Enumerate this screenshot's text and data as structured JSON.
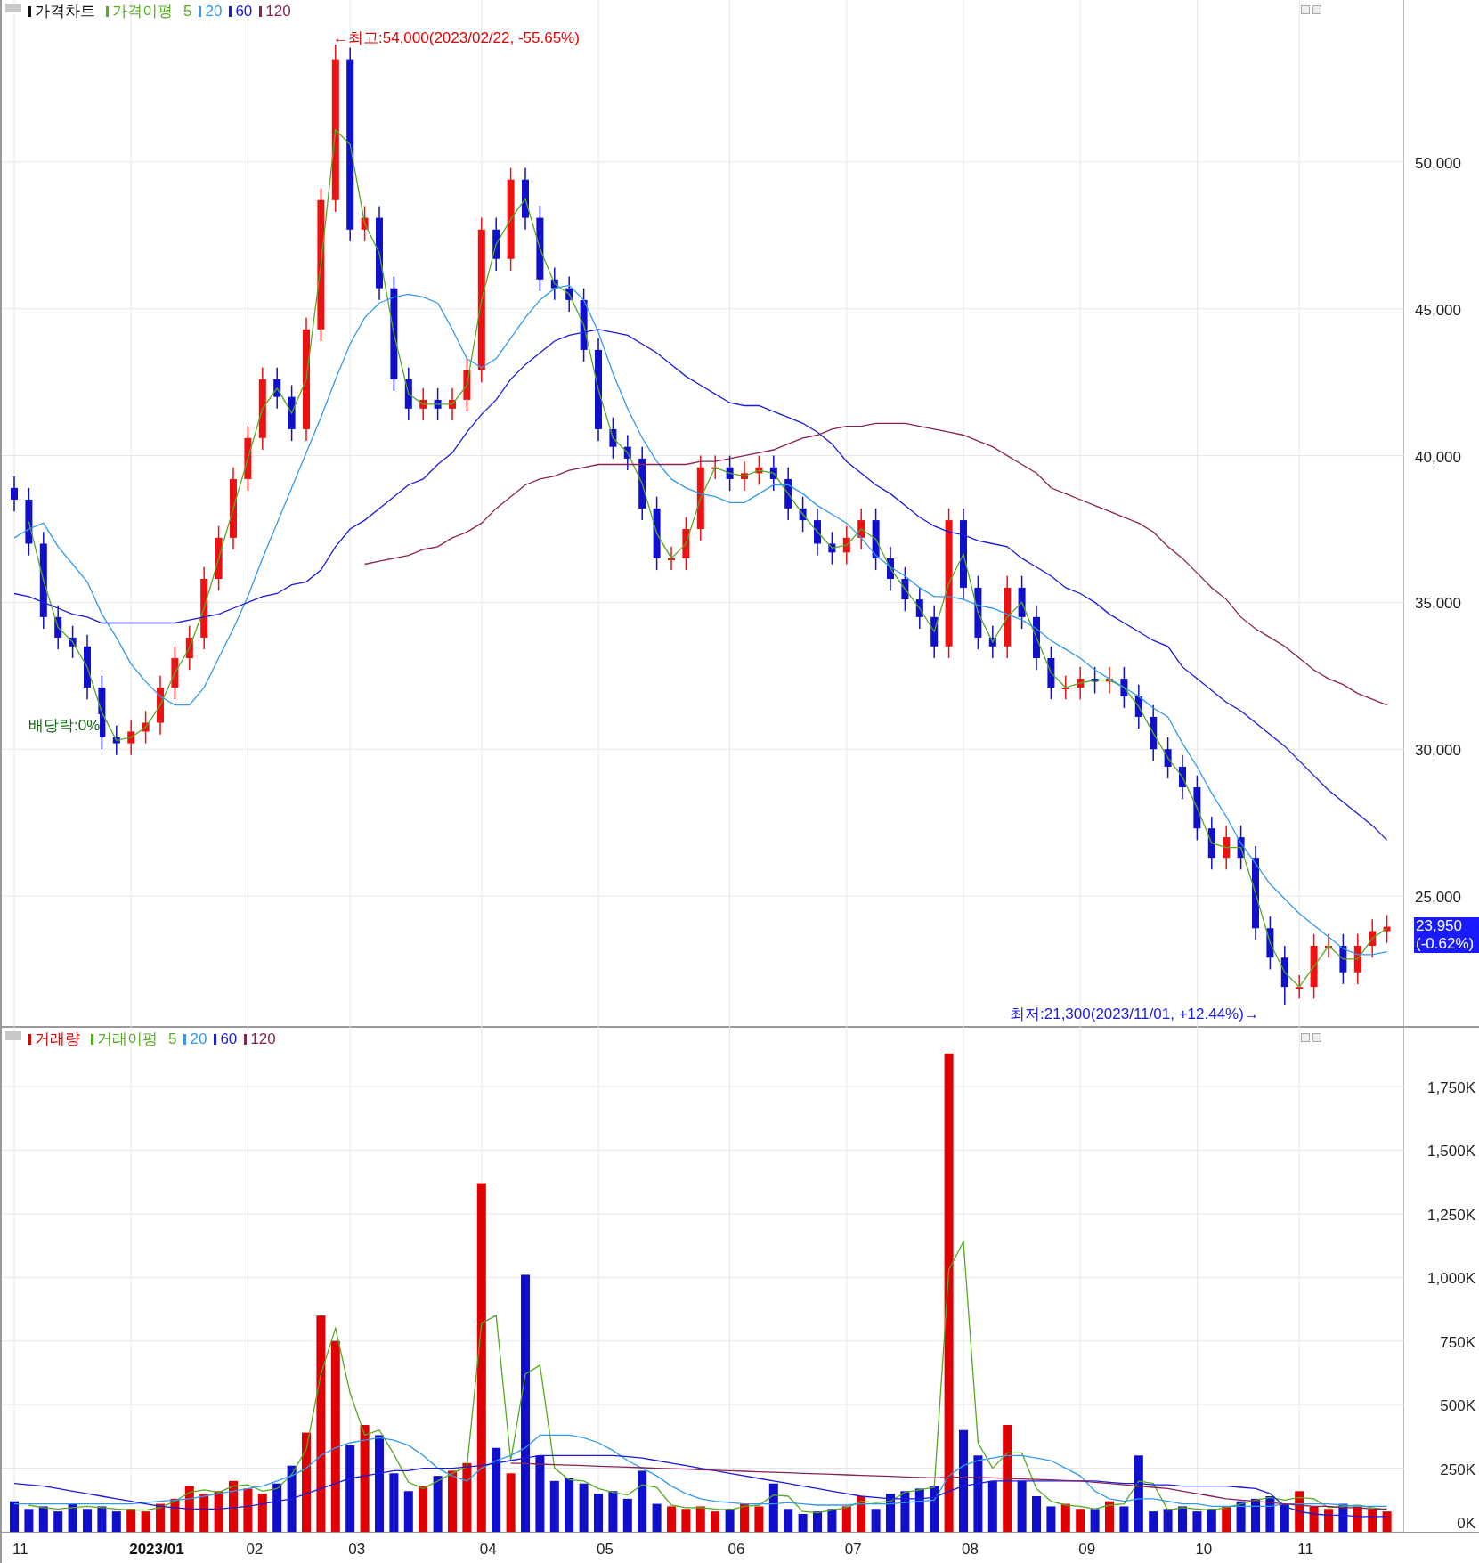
{
  "price_panel": {
    "legend": {
      "title": "가격차트",
      "ma_label": "가격이평"
    },
    "high_marker": "←최고:54,000(2023/02/22, -55.65%)",
    "low_marker": "최저:21,300(2023/11/01, +12.44%)→",
    "dividend_marker": "배당락:0%",
    "current_price": "23,950",
    "current_change": "(-0.62%)",
    "chart_data": {
      "type": "candlestick",
      "ylim": [
        20510,
        55520
      ],
      "grid": true,
      "legend": "upper left",
      "yticks": [
        {
          "value": 25000,
          "label": "25,000"
        },
        {
          "value": 30000,
          "label": "30,000"
        },
        {
          "value": 35000,
          "label": "35,000"
        },
        {
          "value": 40000,
          "label": "40,000"
        },
        {
          "value": 45000,
          "label": "45,000"
        },
        {
          "value": 50000,
          "label": "50,000"
        }
      ],
      "ohlc": [
        [
          38900,
          39300,
          38100,
          38500
        ],
        [
          38500,
          38900,
          36600,
          37000
        ],
        [
          37000,
          37400,
          34100,
          34500
        ],
        [
          34500,
          34900,
          33400,
          33800
        ],
        [
          33800,
          34200,
          33100,
          33500
        ],
        [
          33500,
          33900,
          31700,
          32100
        ],
        [
          32100,
          32500,
          30000,
          30400
        ],
        [
          30400,
          30800,
          29800,
          30200
        ],
        [
          30200,
          31000,
          29800,
          30600
        ],
        [
          30600,
          31300,
          30200,
          30900
        ],
        [
          30900,
          32500,
          30500,
          32100
        ],
        [
          32100,
          33500,
          31700,
          33100
        ],
        [
          33100,
          34200,
          32700,
          33800
        ],
        [
          33800,
          36200,
          33400,
          35800
        ],
        [
          35800,
          37600,
          35400,
          37200
        ],
        [
          37200,
          39600,
          36800,
          39200
        ],
        [
          39200,
          41000,
          38800,
          40600
        ],
        [
          40600,
          43000,
          40200,
          42600
        ],
        [
          42600,
          43000,
          41600,
          42000
        ],
        [
          42000,
          42400,
          40500,
          40900
        ],
        [
          40900,
          44700,
          40500,
          44300
        ],
        [
          44300,
          49100,
          43900,
          48700
        ],
        [
          48700,
          54000,
          48300,
          53500
        ],
        [
          53500,
          53900,
          47300,
          47700
        ],
        [
          47700,
          48500,
          47300,
          48100
        ],
        [
          48100,
          48500,
          45300,
          45700
        ],
        [
          45700,
          46100,
          42200,
          42600
        ],
        [
          42600,
          43000,
          41200,
          41600
        ],
        [
          41600,
          42300,
          41200,
          41900
        ],
        [
          41900,
          42300,
          41200,
          41600
        ],
        [
          41600,
          42300,
          41200,
          41900
        ],
        [
          41900,
          43300,
          41500,
          42900
        ],
        [
          42900,
          48100,
          42500,
          47700
        ],
        [
          47700,
          48100,
          46300,
          46700
        ],
        [
          46700,
          49800,
          46300,
          49400
        ],
        [
          49400,
          49800,
          47700,
          48100
        ],
        [
          48100,
          48500,
          45600,
          46000
        ],
        [
          46000,
          46400,
          45300,
          45700
        ],
        [
          45700,
          46100,
          44900,
          45300
        ],
        [
          45300,
          45700,
          43200,
          43600
        ],
        [
          43600,
          44000,
          40500,
          40900
        ],
        [
          40900,
          41300,
          39900,
          40300
        ],
        [
          40300,
          40700,
          39500,
          39900
        ],
        [
          39900,
          40300,
          37800,
          38200
        ],
        [
          38200,
          38600,
          36100,
          36500
        ],
        [
          36500,
          36900,
          36100,
          36500
        ],
        [
          36500,
          37900,
          36100,
          37500
        ],
        [
          37500,
          40000,
          37100,
          39600
        ],
        [
          39600,
          40000,
          39200,
          39600
        ],
        [
          39600,
          40000,
          38800,
          39200
        ],
        [
          39200,
          39800,
          38800,
          39400
        ],
        [
          39400,
          40000,
          39000,
          39600
        ],
        [
          39600,
          40000,
          38800,
          39200
        ],
        [
          39200,
          39600,
          37800,
          38200
        ],
        [
          38200,
          38600,
          37400,
          37800
        ],
        [
          37800,
          38200,
          36600,
          37000
        ],
        [
          37000,
          37400,
          36300,
          36700
        ],
        [
          36700,
          37600,
          36300,
          37200
        ],
        [
          37200,
          38200,
          36800,
          37800
        ],
        [
          37800,
          38200,
          36100,
          36500
        ],
        [
          36500,
          36900,
          35400,
          35800
        ],
        [
          35800,
          36200,
          34700,
          35100
        ],
        [
          35100,
          35500,
          34100,
          34500
        ],
        [
          34500,
          34900,
          33100,
          33500
        ],
        [
          33500,
          38200,
          33100,
          37800
        ],
        [
          37800,
          38200,
          35100,
          35500
        ],
        [
          35500,
          35900,
          33400,
          33800
        ],
        [
          33800,
          34200,
          33100,
          33500
        ],
        [
          33500,
          35900,
          33100,
          35500
        ],
        [
          35500,
          35900,
          34100,
          34500
        ],
        [
          34500,
          34900,
          32700,
          33100
        ],
        [
          33100,
          33500,
          31700,
          32100
        ],
        [
          32100,
          32500,
          31700,
          32100
        ],
        [
          32100,
          32800,
          31700,
          32400
        ],
        [
          32400,
          32800,
          31900,
          32300
        ],
        [
          32300,
          32800,
          31900,
          32400
        ],
        [
          32400,
          32800,
          31400,
          31800
        ],
        [
          31800,
          32200,
          30700,
          31100
        ],
        [
          31100,
          31500,
          29600,
          30000
        ],
        [
          30000,
          30400,
          29000,
          29400
        ],
        [
          29400,
          29800,
          28300,
          28700
        ],
        [
          28700,
          29100,
          26900,
          27300
        ],
        [
          27300,
          27700,
          25900,
          26300
        ],
        [
          26300,
          27400,
          25900,
          27000
        ],
        [
          27000,
          27400,
          25900,
          26300
        ],
        [
          26300,
          26700,
          23500,
          23900
        ],
        [
          23900,
          24300,
          22500,
          22900
        ],
        [
          22900,
          23300,
          21300,
          21900
        ],
        [
          21900,
          22300,
          21500,
          21900
        ],
        [
          21900,
          23700,
          21500,
          23300
        ],
        [
          23300,
          23700,
          22900,
          23300
        ],
        [
          23300,
          23700,
          22000,
          22400
        ],
        [
          22400,
          23700,
          22000,
          23300
        ],
        [
          23300,
          24200,
          22900,
          23800
        ],
        [
          23800,
          24350,
          23400,
          23950
        ]
      ],
      "series": [
        {
          "name": "5",
          "type": "line",
          "color": "#55aa22",
          "values": [
            null,
            37750,
            35750,
            34150,
            33650,
            32800,
            31250,
            30300,
            30400,
            30750,
            31500,
            32600,
            33450,
            34800,
            36500,
            38200,
            39900,
            41600,
            42300,
            41450,
            42600,
            46500,
            51100,
            50600,
            47900,
            46900,
            44150,
            42100,
            41750,
            41750,
            41750,
            42400,
            45300,
            47200,
            48050,
            48750,
            47050,
            45850,
            45500,
            44450,
            42250,
            40600,
            40100,
            39050,
            37350,
            36500,
            37000,
            38550,
            39600,
            39400,
            39300,
            39500,
            39400,
            38700,
            38000,
            37400,
            36850,
            36950,
            37500,
            37150,
            36150,
            35450,
            34800,
            34000,
            35650,
            36650,
            34650,
            33650,
            34500,
            35000,
            33800,
            32600,
            32100,
            32250,
            32350,
            32350,
            32100,
            31450,
            30550,
            29700,
            29050,
            28000,
            26800,
            26650,
            26650,
            25100,
            23400,
            22400,
            21900,
            22600,
            23300,
            22850,
            22850,
            23550,
            23900
          ]
        },
        {
          "name": "20",
          "type": "line",
          "color": "#3399ee",
          "values": [
            37200,
            37500,
            37700,
            36900,
            36300,
            35700,
            34600,
            33800,
            32900,
            32300,
            31800,
            31500,
            31500,
            32100,
            33100,
            34100,
            35200,
            36500,
            37700,
            38900,
            40100,
            41300,
            42600,
            43800,
            44700,
            45200,
            45400,
            45500,
            45400,
            45200,
            44300,
            43300,
            43000,
            43300,
            44000,
            44700,
            45300,
            45700,
            45800,
            45300,
            44200,
            42800,
            41600,
            40600,
            39800,
            39200,
            38900,
            38700,
            38600,
            38400,
            38400,
            38700,
            39000,
            39000,
            38700,
            38300,
            38000,
            37700,
            37200,
            36600,
            36200,
            35900,
            35500,
            35200,
            35200,
            35100,
            34900,
            34800,
            34600,
            34400,
            34100,
            33700,
            33400,
            33100,
            32700,
            32400,
            32100,
            31800,
            31400,
            31100,
            30200,
            29400,
            28500,
            27700,
            26800,
            26100,
            25400,
            24900,
            24400,
            24000,
            23600,
            23200,
            23000,
            23000,
            23100
          ]
        },
        {
          "name": "60",
          "type": "line",
          "color": "#1a1add",
          "values": [
            35300,
            35200,
            35000,
            34800,
            34600,
            34500,
            34300,
            34300,
            34300,
            34300,
            34300,
            34300,
            34400,
            34500,
            34600,
            34800,
            35000,
            35200,
            35300,
            35600,
            35700,
            36100,
            36900,
            37500,
            37800,
            38200,
            38600,
            39000,
            39200,
            39700,
            40100,
            40800,
            41400,
            41900,
            42600,
            43100,
            43500,
            43900,
            44100,
            44200,
            44300,
            44200,
            44100,
            43800,
            43500,
            43100,
            42700,
            42400,
            42100,
            41800,
            41700,
            41700,
            41500,
            41300,
            41100,
            40800,
            40400,
            39800,
            39400,
            39000,
            38700,
            38300,
            37900,
            37600,
            37400,
            37300,
            37100,
            37000,
            36900,
            36500,
            36200,
            35900,
            35500,
            35300,
            35000,
            34600,
            34300,
            34000,
            33700,
            33500,
            32800,
            32400,
            32000,
            31600,
            31300,
            30900,
            30500,
            30100,
            29600,
            29100,
            28600,
            28200,
            27800,
            27400,
            26900
          ]
        },
        {
          "name": "120",
          "type": "line",
          "color": "#882255",
          "values": [
            null,
            null,
            null,
            null,
            null,
            null,
            null,
            null,
            null,
            null,
            null,
            null,
            null,
            null,
            null,
            null,
            null,
            null,
            null,
            null,
            null,
            null,
            null,
            null,
            36300,
            36400,
            36500,
            36600,
            36800,
            36900,
            37200,
            37400,
            37700,
            38200,
            38600,
            39000,
            39200,
            39300,
            39500,
            39600,
            39700,
            39700,
            39700,
            39700,
            39700,
            39700,
            39700,
            39800,
            39800,
            39900,
            40000,
            40100,
            40200,
            40400,
            40600,
            40700,
            40900,
            41000,
            41000,
            41100,
            41100,
            41100,
            41000,
            40900,
            40800,
            40700,
            40500,
            40300,
            40000,
            39700,
            39400,
            38900,
            38700,
            38500,
            38300,
            38100,
            37900,
            37700,
            37400,
            36900,
            36500,
            36000,
            35500,
            35100,
            34500,
            34100,
            33800,
            33500,
            33100,
            32700,
            32400,
            32200,
            31900,
            31700,
            31500
          ]
        }
      ]
    }
  },
  "volume_panel": {
    "legend": {
      "ma_label": "거래이평"
    },
    "date_labels": [
      "11",
      "2023/01",
      "02",
      "03",
      "04",
      "05",
      "06",
      "07",
      "08",
      "09",
      "10",
      "11"
    ],
    "chart_data": {
      "type": "bar",
      "ylim": [
        0,
        1981
      ],
      "grid": true,
      "legend": "upper left",
      "yticks": [
        {
          "value": 0,
          "label": "0K"
        },
        {
          "value": 250,
          "label": "250K"
        },
        {
          "value": 500,
          "label": "500K"
        },
        {
          "value": 750,
          "label": "750K"
        },
        {
          "value": 1000,
          "label": "1,000K"
        },
        {
          "value": 1250,
          "label": "1,250K"
        },
        {
          "value": 1500,
          "label": "1,500K"
        },
        {
          "value": 1750,
          "label": "1,750K"
        }
      ],
      "series": [
        {
          "name": "거래량",
          "type": "bar",
          "color": "#e00000",
          "values": [
            null,
            null,
            null,
            null,
            null,
            null,
            null,
            null,
            90,
            80,
            110,
            130,
            180,
            150,
            160,
            200,
            170,
            150,
            null,
            null,
            390,
            850,
            750,
            null,
            420,
            null,
            null,
            null,
            180,
            null,
            240,
            270,
            1370,
            null,
            230,
            null,
            null,
            null,
            null,
            null,
            null,
            null,
            null,
            null,
            null,
            100,
            90,
            100,
            80,
            null,
            110,
            100,
            null,
            null,
            null,
            null,
            null,
            100,
            140,
            null,
            null,
            null,
            null,
            null,
            1880,
            null,
            null,
            null,
            420,
            null,
            null,
            null,
            110,
            90,
            null,
            120,
            null,
            null,
            null,
            null,
            null,
            null,
            null,
            100,
            null,
            null,
            null,
            null,
            160,
            100,
            90,
            null,
            100,
            90,
            80
          ]
        },
        {
          "type": "bar",
          "color": "#1010cc",
          "values": [
            120,
            90,
            100,
            80,
            110,
            90,
            100,
            80,
            null,
            null,
            null,
            null,
            null,
            null,
            null,
            null,
            null,
            null,
            190,
            260,
            null,
            null,
            null,
            340,
            null,
            380,
            230,
            160,
            null,
            220,
            null,
            null,
            null,
            330,
            null,
            1010,
            300,
            200,
            210,
            190,
            150,
            160,
            130,
            240,
            110,
            null,
            null,
            null,
            null,
            90,
            null,
            null,
            190,
            90,
            70,
            80,
            90,
            null,
            null,
            90,
            150,
            160,
            170,
            180,
            null,
            400,
            300,
            200,
            null,
            200,
            140,
            100,
            null,
            null,
            90,
            null,
            100,
            300,
            80,
            90,
            100,
            80,
            90,
            null,
            120,
            130,
            140,
            110,
            null,
            null,
            null,
            110,
            null,
            null,
            null
          ]
        },
        {
          "name": "5",
          "type": "line",
          "color": "#55aa22",
          "values": [
            null,
            105,
            95,
            90,
            95,
            100,
            95,
            90,
            85,
            85,
            95,
            120,
            155,
            165,
            155,
            180,
            185,
            160,
            170,
            225,
            325,
            620,
            800,
            545,
            380,
            400,
            305,
            195,
            170,
            200,
            230,
            255,
            820,
            850,
            280,
            620,
            655,
            250,
            205,
            200,
            170,
            155,
            145,
            185,
            175,
            105,
            95,
            95,
            90,
            85,
            100,
            105,
            145,
            140,
            80,
            75,
            85,
            95,
            120,
            115,
            120,
            155,
            165,
            175,
            1030,
            1140,
            350,
            250,
            310,
            310,
            170,
            120,
            105,
            100,
            90,
            105,
            110,
            200,
            190,
            85,
            95,
            90,
            85,
            95,
            110,
            125,
            135,
            125,
            135,
            130,
            95,
            100,
            105,
            95,
            85
          ]
        },
        {
          "name": "20",
          "type": "line",
          "color": "#3399ee",
          "values": [
            110,
            110,
            110,
            110,
            110,
            110,
            110,
            110,
            110,
            115,
            120,
            125,
            130,
            140,
            150,
            160,
            170,
            180,
            200,
            220,
            250,
            300,
            330,
            350,
            360,
            370,
            360,
            340,
            300,
            250,
            220,
            200,
            250,
            280,
            300,
            330,
            380,
            380,
            380,
            370,
            350,
            320,
            280,
            250,
            220,
            180,
            150,
            130,
            120,
            115,
            110,
            110,
            110,
            115,
            110,
            105,
            105,
            105,
            110,
            110,
            110,
            115,
            120,
            125,
            220,
            260,
            280,
            290,
            300,
            300,
            290,
            280,
            250,
            220,
            160,
            130,
            120,
            130,
            130,
            120,
            110,
            110,
            100,
            100,
            100,
            100,
            100,
            110,
            110,
            110,
            110,
            105,
            100,
            100,
            100
          ]
        },
        {
          "name": "60",
          "type": "line",
          "color": "#1a1add",
          "values": [
            190,
            185,
            180,
            170,
            160,
            150,
            140,
            130,
            120,
            110,
            100,
            95,
            90,
            90,
            90,
            95,
            100,
            110,
            120,
            130,
            150,
            170,
            190,
            210,
            220,
            230,
            240,
            240,
            250,
            250,
            250,
            255,
            260,
            270,
            280,
            290,
            300,
            300,
            300,
            300,
            300,
            300,
            295,
            290,
            280,
            270,
            260,
            250,
            240,
            230,
            220,
            210,
            200,
            190,
            180,
            170,
            160,
            150,
            140,
            135,
            130,
            130,
            130,
            135,
            160,
            180,
            190,
            200,
            200,
            200,
            200,
            200,
            200,
            200,
            200,
            195,
            190,
            190,
            185,
            185,
            180,
            180,
            180,
            180,
            175,
            170,
            150,
            100,
            80,
            70,
            65,
            65,
            60,
            60,
            60
          ]
        },
        {
          "name": "120",
          "type": "line",
          "color": "#882255",
          "values": [
            null,
            null,
            null,
            null,
            null,
            null,
            null,
            null,
            null,
            null,
            null,
            null,
            null,
            null,
            null,
            null,
            null,
            null,
            null,
            null,
            null,
            null,
            null,
            null,
            null,
            null,
            null,
            null,
            null,
            null,
            null,
            null,
            null,
            null,
            270,
            268,
            266,
            264,
            262,
            260,
            258,
            256,
            254,
            252,
            250,
            248,
            246,
            244,
            242,
            240,
            238,
            236,
            234,
            232,
            230,
            228,
            226,
            224,
            222,
            220,
            218,
            216,
            214,
            212,
            215,
            215,
            214,
            212,
            210,
            208,
            206,
            204,
            202,
            200,
            195,
            190,
            185,
            180,
            175,
            170,
            160,
            150,
            140,
            130,
            125,
            120,
            115,
            110,
            105,
            100,
            100,
            95,
            95,
            90,
            90
          ]
        }
      ]
    }
  }
}
